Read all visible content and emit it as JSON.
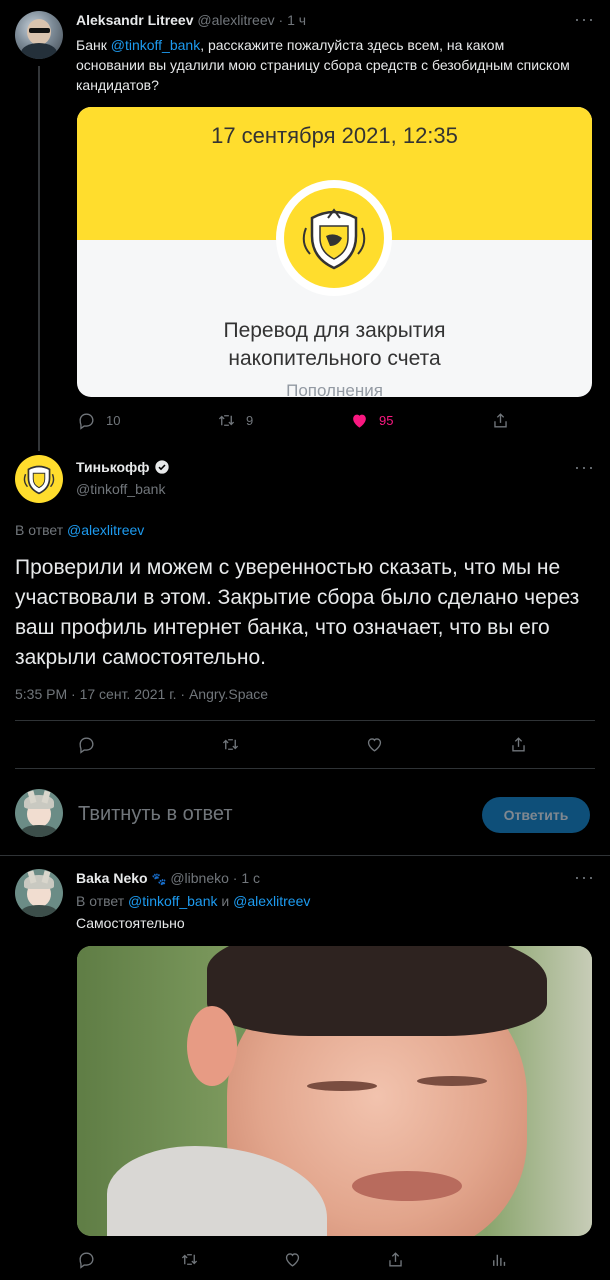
{
  "tweet1": {
    "author_name": "Aleksandr Litreev",
    "author_handle": "@alexlitreev",
    "time": "· 1 ч",
    "text_pre": "Банк ",
    "text_mention": "@tinkoff_bank",
    "text_post": ", расскажите пожалуйста здесь всем, на каком основании вы удалили мою страницу сбора средств с безобидным списком кандидатов?",
    "card": {
      "date": "17 сентября 2021, 12:35",
      "title_line1": "Перевод для закрытия",
      "title_line2": "накопительного счета",
      "subtitle": "Пополнения"
    },
    "actions": {
      "replies": "10",
      "retweets": "9",
      "likes": "95"
    }
  },
  "tweet2": {
    "author_name": "Тинькофф",
    "author_handle": "@tinkoff_bank",
    "reply_to_label": "В ответ ",
    "reply_to_handle": "@alexlitreev",
    "text": "Проверили и можем с уверенностью сказать, что мы не участвовали в этом. Закрытие сбора было сделано через ваш профиль интернет банка, что означает, что вы его закрыли самостоятельно.",
    "meta": "5:35 PM · 17 сент. 2021 г. · Angry.Space"
  },
  "reply_box": {
    "placeholder": "Твитнуть в ответ",
    "button": "Ответить"
  },
  "tweet3": {
    "author_name": "Baka Neko",
    "emoji": "🐾",
    "author_handle": "@libneko",
    "time": "· 1 с",
    "reply_to_label": "В ответ ",
    "reply_to_handle1": "@tinkoff_bank",
    "reply_to_and": " и ",
    "reply_to_handle2": "@alexlitreev",
    "text": "Самостоятельно"
  },
  "colors": {
    "accent": "#1d9bf0",
    "like": "#f91880",
    "tinkoff_yellow": "#ffdd2d",
    "reply_button": "#0e4f79"
  },
  "icons": [
    "more-icon",
    "reply-icon",
    "retweet-icon",
    "like-icon",
    "share-icon",
    "analytics-icon",
    "verified-icon",
    "tinkoff-logo"
  ]
}
